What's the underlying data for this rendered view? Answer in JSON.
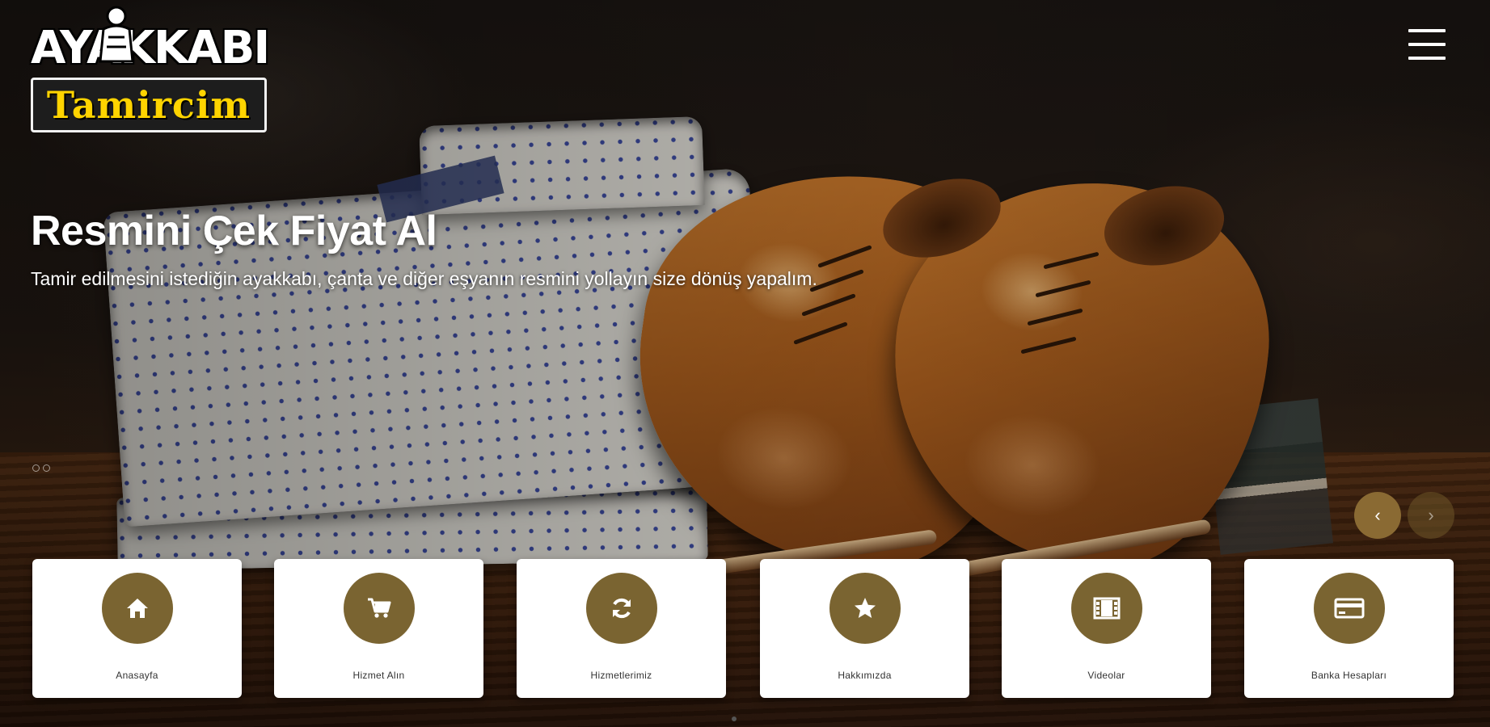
{
  "logo": {
    "line1": "AYAKKABI",
    "line2": "Tamircim"
  },
  "hero": {
    "title": "Resmini Çek Fiyat Al",
    "subtitle": "Tamir edilmesini istediğin ayakkabı, çanta ve diğer eşyanın resmini yollayın size dönüş yapalım."
  },
  "slider": {
    "prev_symbol": "‹",
    "next_symbol": "›"
  },
  "cards": [
    {
      "label": "Anasayfa",
      "icon": "home-icon"
    },
    {
      "label": "Hizmet Alın",
      "icon": "cart-icon"
    },
    {
      "label": "Hizmetlerimiz",
      "icon": "refresh-icon"
    },
    {
      "label": "Hakkımızda",
      "icon": "star-icon"
    },
    {
      "label": "Videolar",
      "icon": "film-icon"
    },
    {
      "label": "Banka Hesapları",
      "icon": "credit-card-icon"
    }
  ],
  "colors": {
    "accent": "#7a6431",
    "logo_yellow": "#ffd400"
  }
}
